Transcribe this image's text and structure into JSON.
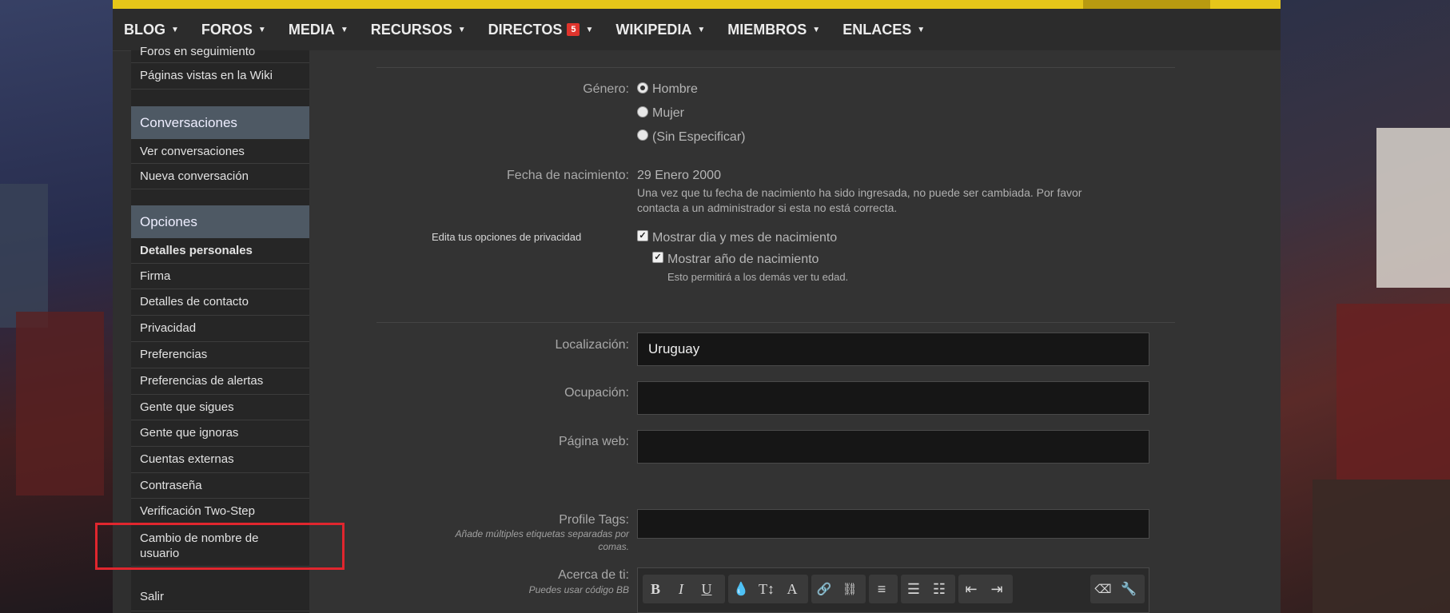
{
  "nav": {
    "items": [
      {
        "label": "BLOG"
      },
      {
        "label": "FOROS"
      },
      {
        "label": "MEDIA"
      },
      {
        "label": "RECURSOS"
      },
      {
        "label": "DIRECTOS",
        "badge": "5"
      },
      {
        "label": "WIKIPEDIA"
      },
      {
        "label": "MIEMBROS"
      },
      {
        "label": "ENLACES"
      }
    ]
  },
  "sidebar": {
    "partial_item": "Foros en seguimiento",
    "wiki_item": "Páginas vistas en la Wiki",
    "conversaciones": {
      "heading": "Conversaciones",
      "items": [
        "Ver conversaciones",
        "Nueva conversación"
      ]
    },
    "opciones": {
      "heading": "Opciones",
      "items": [
        "Detalles personales",
        "Firma",
        "Detalles de contacto",
        "Privacidad",
        "Preferencias",
        "Preferencias de alertas",
        "Gente que sigues",
        "Gente que ignoras",
        "Cuentas externas",
        "Contraseña",
        "Verificación Two-Step",
        "Cambio de nombre de usuario"
      ]
    },
    "logout": "Salir"
  },
  "form": {
    "genero": {
      "label": "Género:",
      "options": [
        "Hombre",
        "Mujer",
        "(Sin Especificar)"
      ],
      "selected": "Hombre"
    },
    "fecha": {
      "label": "Fecha de nacimiento:",
      "value": "29 Enero 2000",
      "note_line1": "Una vez que tu fecha de nacimiento ha sido ingresada, no puede ser cambiada. Por favor",
      "note_line2": "contacta a un administrador si esta no está correcta."
    },
    "privacidad": {
      "label": "Edita tus opciones de privacidad",
      "check1": "Mostrar dia y mes de nacimiento",
      "check2": "Mostrar año de nacimiento",
      "check2_note": "Esto permitirá a los demás ver tu edad."
    },
    "localizacion": {
      "label": "Localización:",
      "value": "Uruguay"
    },
    "ocupacion": {
      "label": "Ocupación:",
      "value": ""
    },
    "web": {
      "label": "Página web:",
      "value": ""
    },
    "tags": {
      "label": "Profile Tags:",
      "hint_line1": "Añade múltiples etiquetas separadas por",
      "hint_line2": "comas.",
      "value": ""
    },
    "acerca": {
      "label": "Acerca de ti:",
      "hint": "Puedes usar código BB"
    }
  },
  "colors": {
    "accent": "#e6c619",
    "badge": "#e0342c",
    "highlight": "#e0262e",
    "sidebar_heading": "#4e5964"
  }
}
